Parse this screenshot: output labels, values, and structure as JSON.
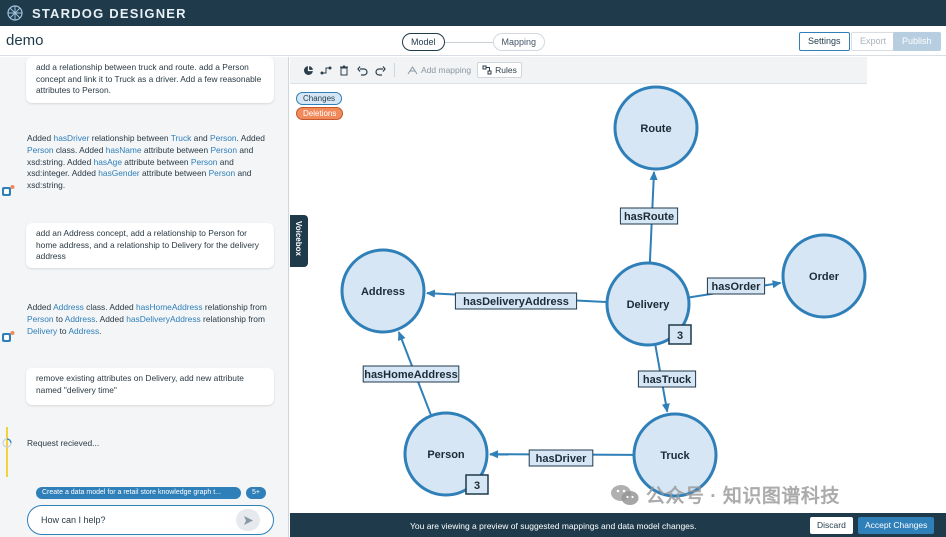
{
  "app": {
    "brand_bold": "STARDOG",
    "brand_light": "DESIGNER",
    "project_name": "demo"
  },
  "stepper": {
    "steps": [
      {
        "label": "Model",
        "active": true
      },
      {
        "label": "Mapping",
        "active": false
      }
    ]
  },
  "header_buttons": {
    "settings": "Settings",
    "export": "Export",
    "publish": "Publish"
  },
  "chat": {
    "user_1": "add a relationship between truck and route. add a Person concept and link it to Truck as a driver. Add a few reasonable attributes to Person.",
    "reply_1": [
      {
        "t": "Added ",
        "hl": false
      },
      {
        "t": "hasDriver",
        "hl": true
      },
      {
        "t": " relationship between ",
        "hl": false
      },
      {
        "t": "Truck",
        "hl": true
      },
      {
        "t": " and ",
        "hl": false
      },
      {
        "t": "Person",
        "hl": true
      },
      {
        "t": ". Added ",
        "hl": false
      },
      {
        "t": "Person",
        "hl": true
      },
      {
        "t": " class. Added ",
        "hl": false
      },
      {
        "t": "hasName",
        "hl": true
      },
      {
        "t": " attribute between ",
        "hl": false
      },
      {
        "t": "Person",
        "hl": true
      },
      {
        "t": " and xsd:string. Added ",
        "hl": false
      },
      {
        "t": "hasAge",
        "hl": true
      },
      {
        "t": " attribute between ",
        "hl": false
      },
      {
        "t": "Person",
        "hl": true
      },
      {
        "t": " and xsd:integer. Added ",
        "hl": false
      },
      {
        "t": "hasGender",
        "hl": true
      },
      {
        "t": " attribute between ",
        "hl": false
      },
      {
        "t": "Person",
        "hl": true
      },
      {
        "t": " and xsd:string.",
        "hl": false
      }
    ],
    "user_2": "add an Address concept, add a relationship to Person for home address, and a relationship to Delivery for the delivery address",
    "reply_2": [
      {
        "t": "Added ",
        "hl": false
      },
      {
        "t": "Address",
        "hl": true
      },
      {
        "t": " class. Added ",
        "hl": false
      },
      {
        "t": "hasHomeAddress",
        "hl": true
      },
      {
        "t": " relationship from ",
        "hl": false
      },
      {
        "t": "Person",
        "hl": true
      },
      {
        "t": " to ",
        "hl": false
      },
      {
        "t": "Address",
        "hl": true
      },
      {
        "t": ". Added ",
        "hl": false
      },
      {
        "t": "hasDeliveryAddress",
        "hl": true
      },
      {
        "t": " relationship from ",
        "hl": false
      },
      {
        "t": "Delivery",
        "hl": true
      },
      {
        "t": " to ",
        "hl": false
      },
      {
        "t": "Address",
        "hl": true
      },
      {
        "t": ".",
        "hl": false
      }
    ],
    "user_3": "remove existing attributes on Delivery, add new attribute named \"delivery time\"",
    "status": "Request recieved...",
    "suggestion": "Create a data model for a retail store knowledge graph t...",
    "more_suggestions": "5+",
    "input_placeholder": "How can I help?"
  },
  "voicebox_label": "Voicebox",
  "toolbar": {
    "add_mapping": "Add mapping",
    "rules": "Rules"
  },
  "legend": {
    "changes": "Changes",
    "deletions": "Deletions"
  },
  "graph": {
    "nodes": [
      {
        "id": "route",
        "label": "Route"
      },
      {
        "id": "order",
        "label": "Order"
      },
      {
        "id": "address",
        "label": "Address"
      },
      {
        "id": "delivery",
        "label": "Delivery",
        "badge": "3"
      },
      {
        "id": "person",
        "label": "Person",
        "badge": "3"
      },
      {
        "id": "truck",
        "label": "Truck"
      }
    ],
    "edges": [
      {
        "id": "hasRoute",
        "label": "hasRoute",
        "from": "delivery",
        "to": "route"
      },
      {
        "id": "hasOrder",
        "label": "hasOrder",
        "from": "delivery",
        "to": "order"
      },
      {
        "id": "hasDeliveryAddress",
        "label": "hasDeliveryAddress",
        "from": "delivery",
        "to": "address"
      },
      {
        "id": "hasTruck",
        "label": "hasTruck",
        "from": "delivery",
        "to": "truck"
      },
      {
        "id": "hasDriver",
        "label": "hasDriver",
        "from": "truck",
        "to": "person"
      },
      {
        "id": "hasHomeAddress",
        "label": "hasHomeAddress",
        "from": "person",
        "to": "address"
      }
    ]
  },
  "banner": {
    "message": "You are viewing a preview of suggested mappings and data model changes.",
    "discard": "Discard",
    "accept": "Accept Changes"
  },
  "watermark": "公众号 · 知识图谱科技",
  "colors": {
    "navy": "#1f3a4b",
    "accent": "#2f7fb8",
    "node_fill": "#d6e6f4",
    "node_stroke": "#2f7fb8",
    "deletion": "#f08a5b"
  }
}
